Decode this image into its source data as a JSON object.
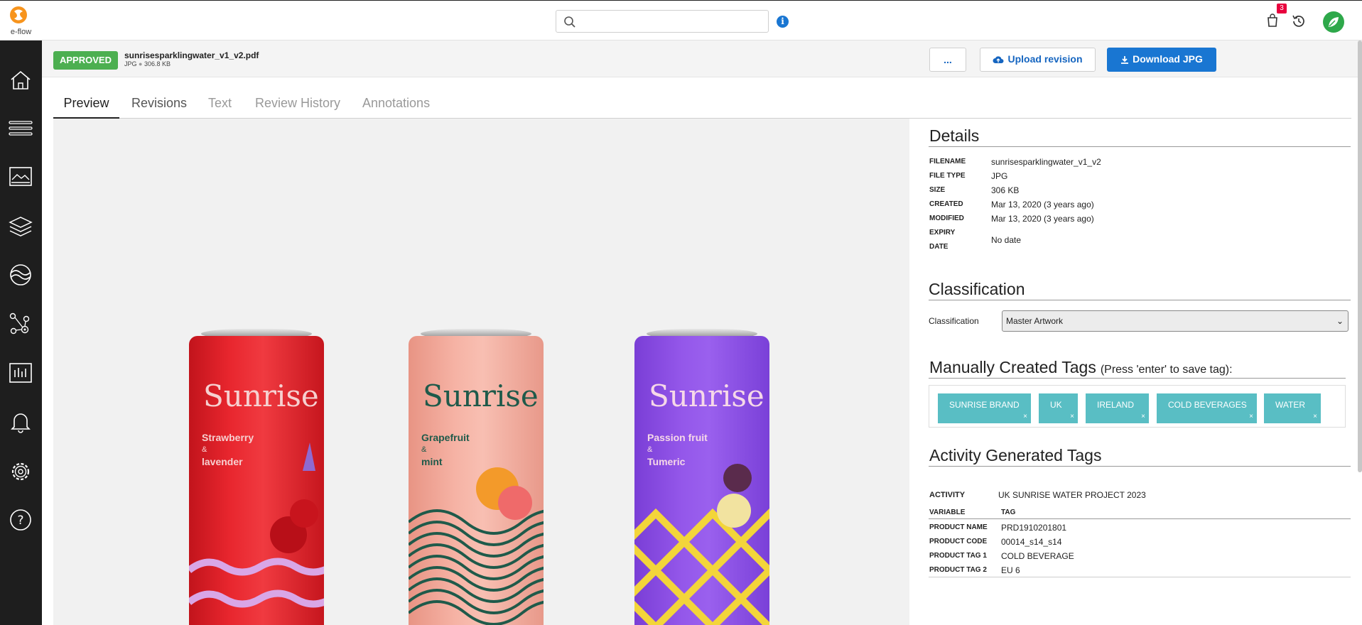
{
  "app": {
    "logo_text": "e-flow",
    "cart_count": "3"
  },
  "search": {
    "placeholder": ""
  },
  "header": {
    "status": "APPROVED",
    "file_name": "sunrisesparklingwater_v1_v2.pdf",
    "file_type": "JPG",
    "file_size": "306.8 KB",
    "more_label": "...",
    "upload_label": "Upload revision",
    "download_label": "Download JPG"
  },
  "tabs": [
    "Preview",
    "Revisions",
    "Text",
    "Review History",
    "Annotations"
  ],
  "preview": {
    "cans": [
      {
        "brand": "Sunrise",
        "flavor_line1": "Strawberry",
        "amp": "&",
        "flavor_line2": "lavender",
        "color": "#e0242c",
        "text_color": "#f6d0d0"
      },
      {
        "brand": "Sunrise",
        "flavor_line1": "Grapefruit",
        "amp": "&",
        "flavor_line2": "mint",
        "color": "#f2a899",
        "text_color": "#1f5a4a"
      },
      {
        "brand": "Sunrise",
        "flavor_line1": "Passion fruit",
        "amp": "&",
        "flavor_line2": "Tumeric",
        "color": "#8a4ee0",
        "text_color": "#f6d8e8"
      }
    ]
  },
  "details": {
    "title": "Details",
    "rows": [
      {
        "label": "FILENAME",
        "value": "sunrisesparklingwater_v1_v2"
      },
      {
        "label": "FILE TYPE",
        "value": "JPG"
      },
      {
        "label": "SIZE",
        "value": "306 KB"
      },
      {
        "label": "CREATED",
        "value": "Mar 13, 2020 (3 years ago)"
      },
      {
        "label": "MODIFIED",
        "value": "Mar 13, 2020 (3 years ago)"
      },
      {
        "label": "EXPIRY",
        "label2": "DATE",
        "value": "No date"
      }
    ]
  },
  "classification": {
    "title": "Classification",
    "label": "Classification",
    "selected": "Master Artwork"
  },
  "manual_tags": {
    "title": "Manually Created Tags",
    "hint": "(Press 'enter' to save tag):",
    "tags": [
      "SUNRISE BRAND",
      "UK",
      "IRELAND",
      "COLD BEVERAGES",
      "WATER"
    ],
    "remove_symbol": "×"
  },
  "activity_tags": {
    "title": "Activity Generated Tags",
    "activity_label": "ACTIVITY",
    "activity_value": "UK SUNRISE WATER PROJECT 2023",
    "col_variable": "VARIABLE",
    "col_tag": "TAG",
    "rows": [
      {
        "variable": "PRODUCT NAME",
        "tag": "PRD1910201801"
      },
      {
        "variable": "PRODUCT CODE",
        "tag": "00014_s14_s14"
      },
      {
        "variable": "PRODUCT TAG 1",
        "tag": "COLD BEVERAGE"
      },
      {
        "variable": "PRODUCT TAG 2",
        "tag": "EU 6"
      }
    ]
  },
  "colors": {
    "accent": "#1976d2",
    "approved": "#4caf50",
    "tag": "#59bec4",
    "sidebar": "#1e1e1e",
    "badge": "#e8003d"
  },
  "icons": [
    "search-icon",
    "info-icon",
    "cart-icon",
    "history-icon",
    "user-avatar",
    "home-icon",
    "list-icon",
    "image-icon",
    "layers-icon",
    "waves-icon",
    "workflow-icon",
    "chart-icon",
    "bell-icon",
    "gear-icon",
    "help-icon",
    "upload-cloud-icon",
    "download-icon"
  ]
}
